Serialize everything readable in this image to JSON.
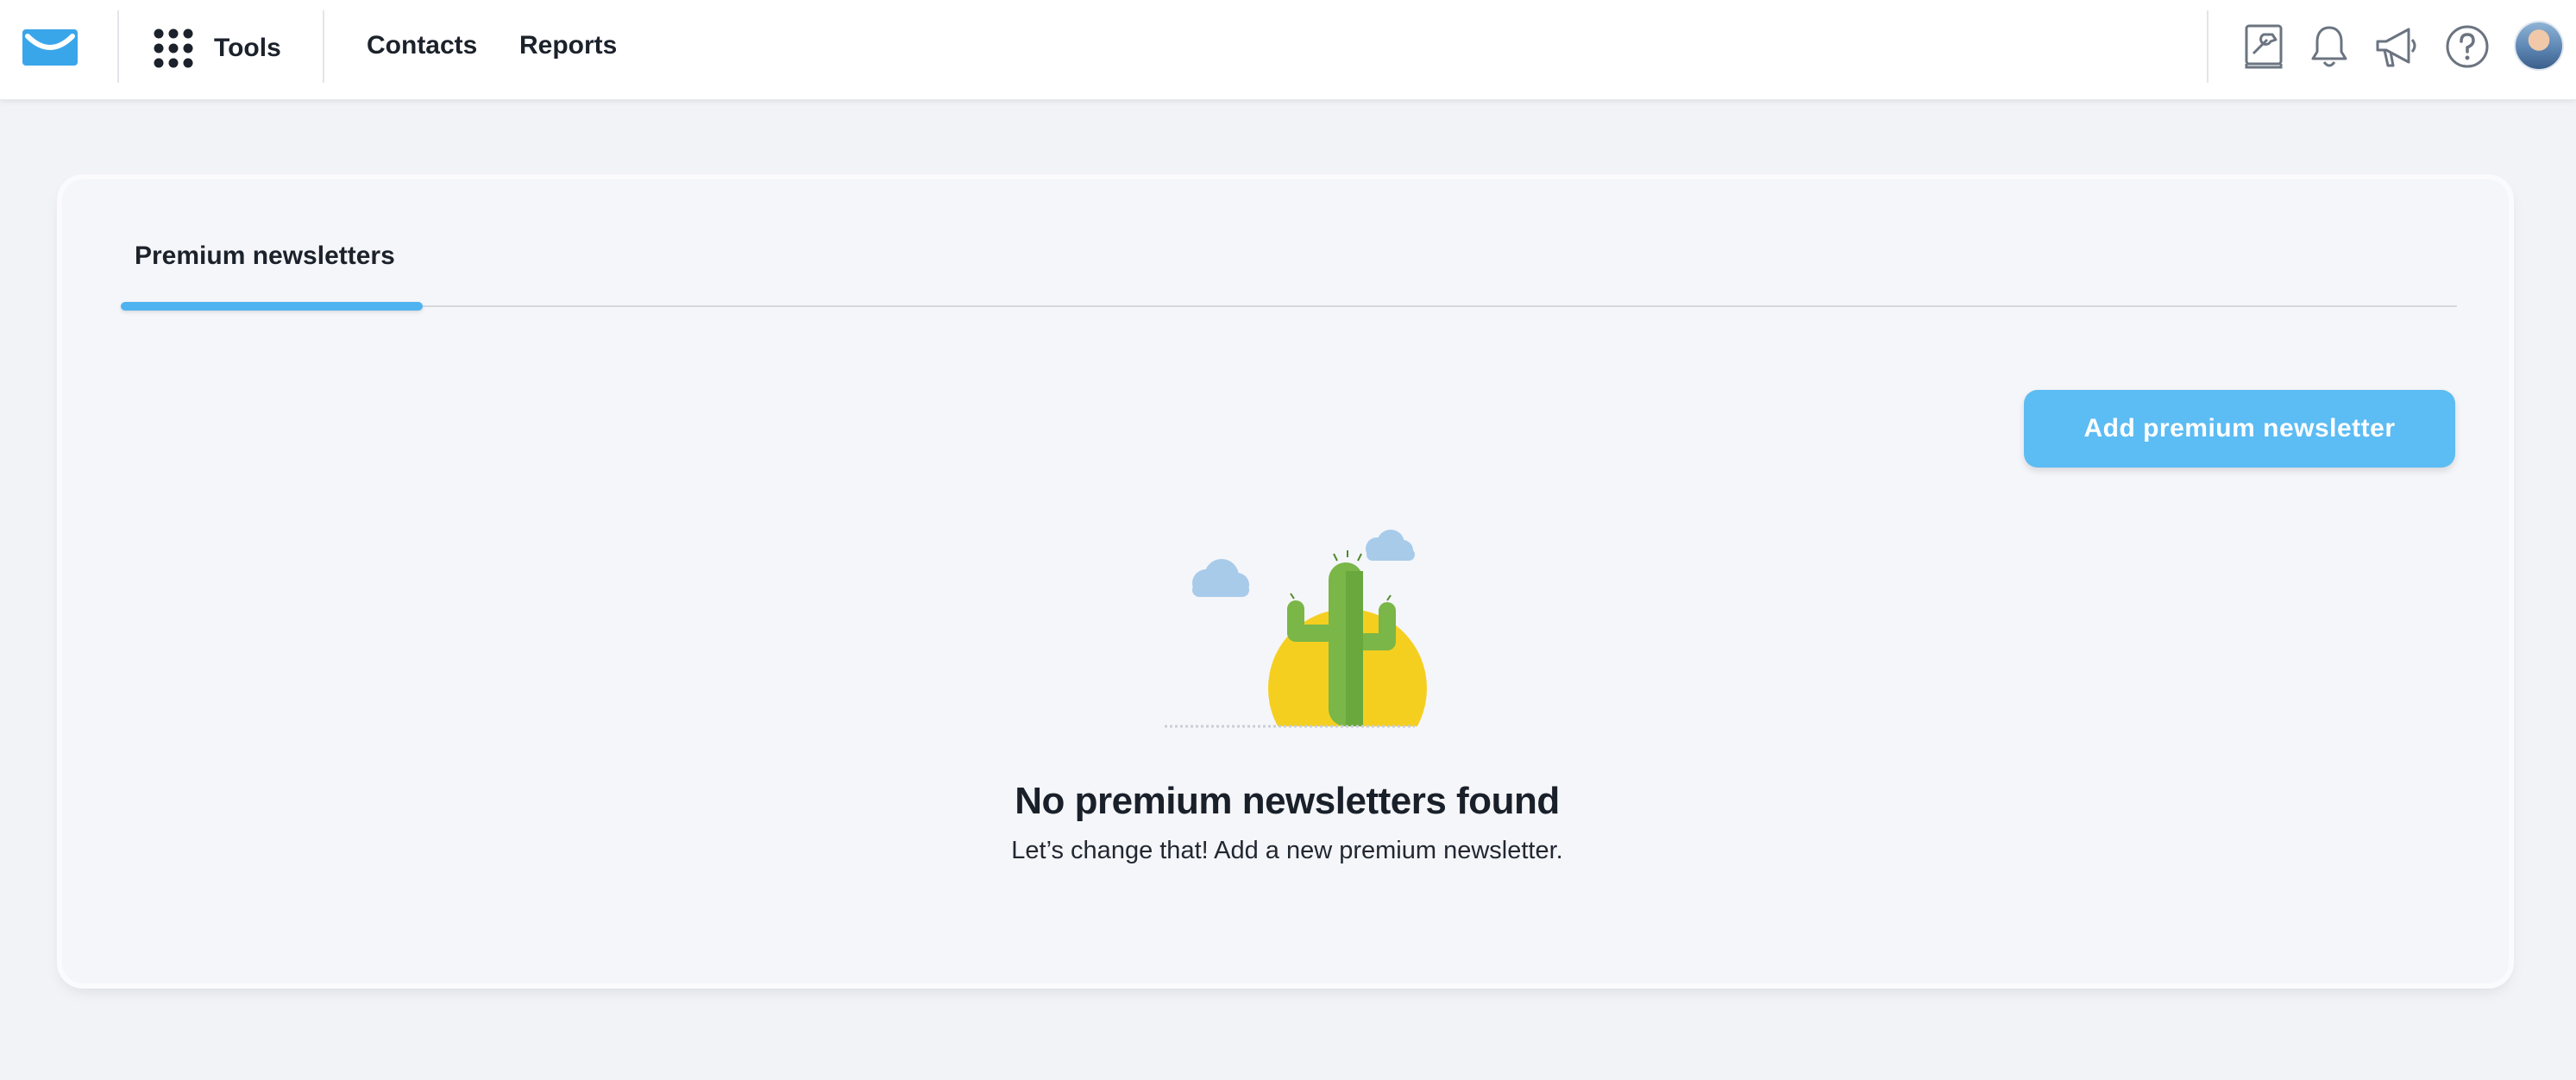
{
  "header": {
    "logo_icon": "envelope-logo-icon",
    "tools_label": "Tools",
    "nav": [
      {
        "label": "Contacts"
      },
      {
        "label": "Reports"
      }
    ],
    "right_icons": [
      "integrations-icon",
      "bell-icon",
      "megaphone-icon",
      "help-icon",
      "avatar"
    ]
  },
  "tabs": [
    {
      "label": "Premium newsletters",
      "active": true
    }
  ],
  "actions": {
    "add_label": "Add premium newsletter"
  },
  "empty_state": {
    "illustration": "cactus-sun-illustration",
    "title": "No premium newsletters found",
    "subtitle": "Let’s change that! Add a new premium newsletter."
  },
  "colors": {
    "accent": "#4fb3f0",
    "button": "#5cbcf4",
    "background": "#f2f3f7"
  }
}
